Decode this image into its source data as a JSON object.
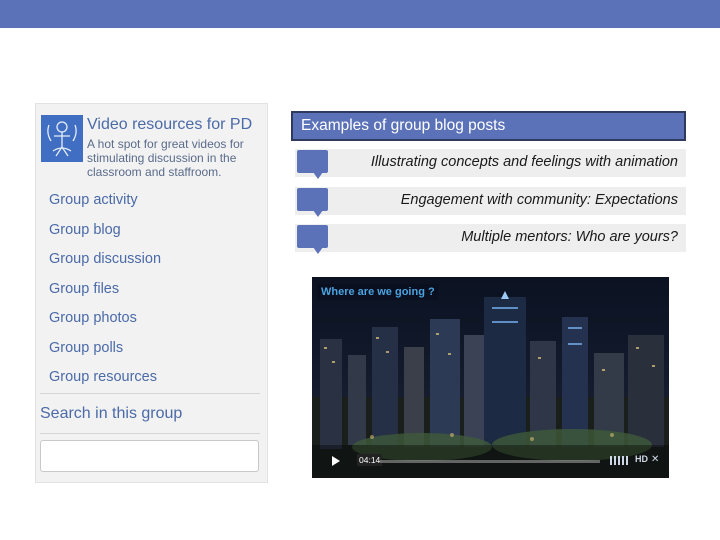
{
  "group": {
    "title": "Video resources for PD",
    "description": "A hot spot for great videos for stimulating discussion in the classroom and staffroom.",
    "nav": [
      {
        "label": "Group activity"
      },
      {
        "label": "Group blog"
      },
      {
        "label": "Group discussion"
      },
      {
        "label": "Group files"
      },
      {
        "label": "Group photos"
      },
      {
        "label": "Group polls"
      },
      {
        "label": "Group resources"
      }
    ],
    "search_title": "Search in this group",
    "search_placeholder": ""
  },
  "posts": {
    "header": "Examples of group blog posts",
    "items": [
      {
        "label": "Illustrating concepts and feelings with animation"
      },
      {
        "label": "Engagement with community: Expectations"
      },
      {
        "label": "Multiple mentors: Who are yours?"
      }
    ]
  },
  "video": {
    "title": "Where are we going ?",
    "time": "04:14",
    "hd_label": "HD"
  },
  "colors": {
    "accent": "#5b72b8",
    "link": "#4a6aa8",
    "panel_bg": "#f2f2f2"
  }
}
